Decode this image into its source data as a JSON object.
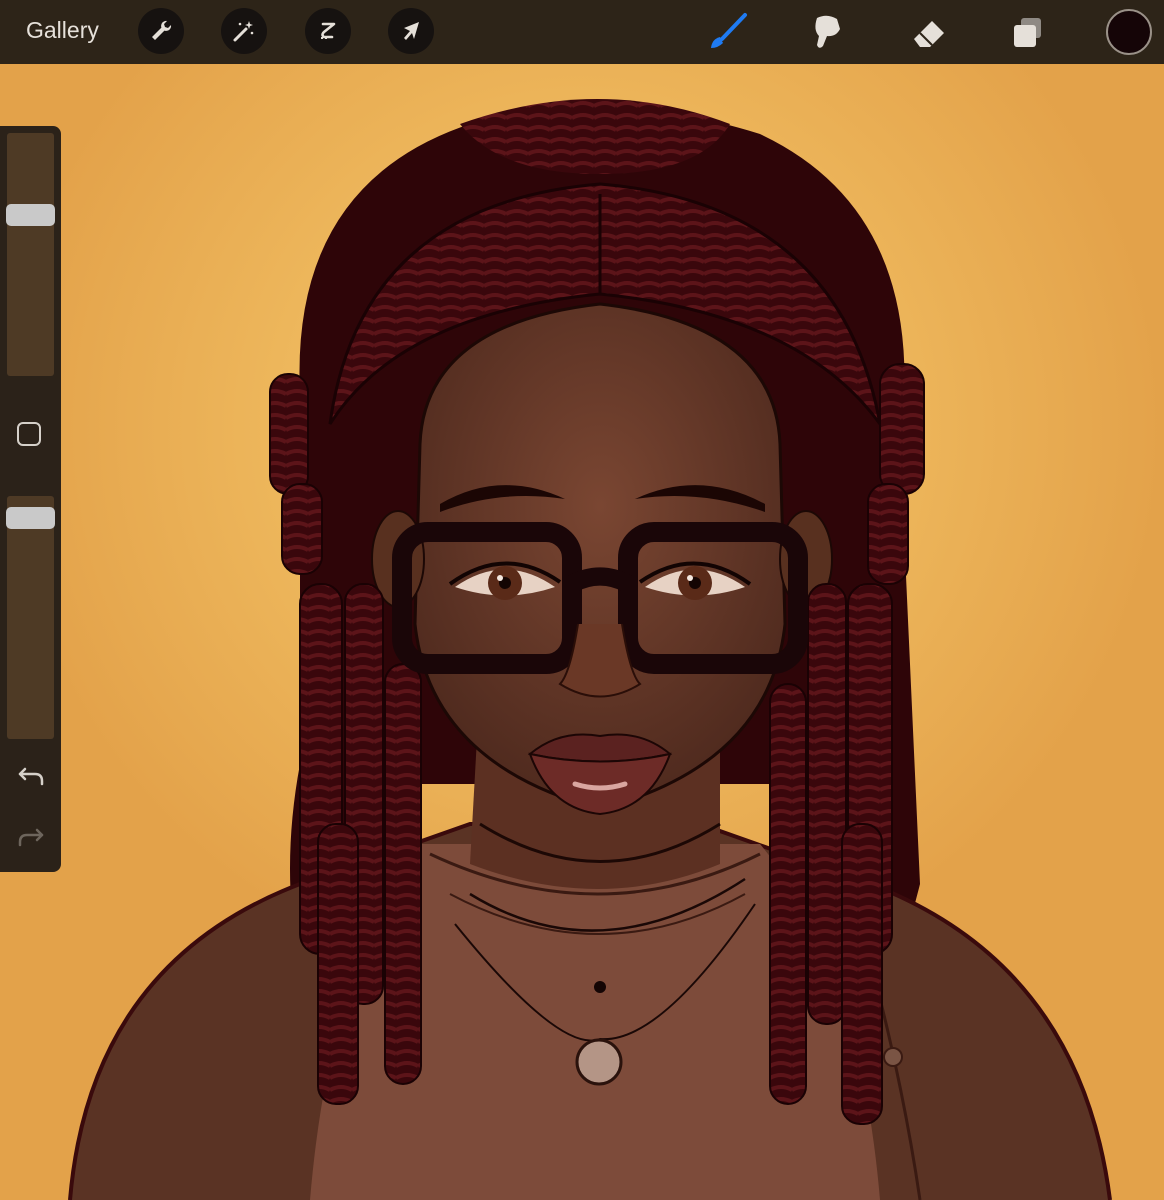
{
  "toolbar": {
    "gallery_label": "Gallery",
    "left_tools": [
      "wrench-icon",
      "magic-wand-icon",
      "selection-s-icon",
      "arrow-cursor-icon"
    ],
    "right_tools": [
      "brush-icon",
      "smudge-icon",
      "eraser-icon",
      "layers-icon"
    ],
    "active_tool": "brush-icon",
    "active_color": "#150507",
    "accent_color": "#1f7bf2"
  },
  "sidebar": {
    "brush_size_level": 0.68,
    "opacity_level": 0.95,
    "controls": [
      "modify-square-icon",
      "undo-icon",
      "redo-icon"
    ]
  },
  "canvas": {
    "background_color": "#e9aa4c"
  }
}
